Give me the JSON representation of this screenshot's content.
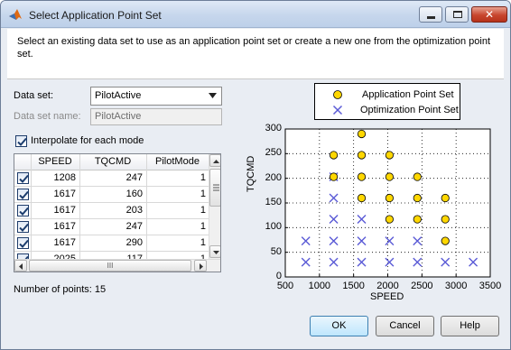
{
  "window": {
    "title": "Select Application Point Set",
    "close_glyph": "✕"
  },
  "description": "Select an existing data set to use as an application point set or create a new one from the optimization point set.",
  "form": {
    "data_set_label": "Data set:",
    "data_set_value": "PilotActive",
    "data_set_name_label": "Data set name:",
    "data_set_name_value": "PilotActive",
    "interpolate_label": "Interpolate for each mode",
    "interpolate_checked": true
  },
  "table": {
    "columns": [
      "SPEED",
      "TQCMD",
      "PilotMode"
    ],
    "rows": [
      {
        "checked": true,
        "speed": "1208",
        "tqcmd": "247",
        "mode": "1"
      },
      {
        "checked": true,
        "speed": "1617",
        "tqcmd": "160",
        "mode": "1"
      },
      {
        "checked": true,
        "speed": "1617",
        "tqcmd": "203",
        "mode": "1"
      },
      {
        "checked": true,
        "speed": "1617",
        "tqcmd": "247",
        "mode": "1"
      },
      {
        "checked": true,
        "speed": "1617",
        "tqcmd": "290",
        "mode": "1"
      },
      {
        "checked": true,
        "speed": "2025",
        "tqcmd": "117",
        "mode": "1"
      }
    ],
    "hscroll_grip": "III"
  },
  "point_count": "Number of points: 15",
  "buttons": {
    "ok": "OK",
    "cancel": "Cancel",
    "help": "Help"
  },
  "colors": {
    "application_marker": "#ffd700",
    "optimization_marker": "#5a5ad6"
  },
  "chart_data": {
    "type": "scatter",
    "title": "",
    "xlabel": "SPEED",
    "ylabel": "TQCMD",
    "xlim": [
      500,
      3500
    ],
    "ylim": [
      0,
      300
    ],
    "xticks": [
      "500",
      "1000",
      "1500",
      "2000",
      "2500",
      "3000",
      "3500"
    ],
    "yticks": [
      "0",
      "50",
      "100",
      "150",
      "200",
      "250",
      "300"
    ],
    "grid": true,
    "legend_position": "above-right",
    "series": [
      {
        "name": "Application Point Set",
        "marker": "circle",
        "points": [
          [
            1208,
            247
          ],
          [
            1617,
            290
          ],
          [
            1617,
            247
          ],
          [
            1617,
            203
          ],
          [
            1617,
            160
          ],
          [
            1208,
            203
          ],
          [
            2025,
            247
          ],
          [
            2025,
            203
          ],
          [
            2025,
            160
          ],
          [
            2025,
            117
          ],
          [
            2433,
            203
          ],
          [
            2433,
            160
          ],
          [
            2433,
            117
          ],
          [
            2842,
            160
          ],
          [
            2842,
            117
          ],
          [
            2842,
            73
          ]
        ]
      },
      {
        "name": "Optimization Point Set",
        "marker": "x",
        "points": [
          [
            800,
            30
          ],
          [
            800,
            73
          ],
          [
            1208,
            30
          ],
          [
            1208,
            73
          ],
          [
            1208,
            117
          ],
          [
            1208,
            160
          ],
          [
            1208,
            203
          ],
          [
            1617,
            30
          ],
          [
            1617,
            73
          ],
          [
            1617,
            117
          ],
          [
            2025,
            30
          ],
          [
            2025,
            73
          ],
          [
            2433,
            30
          ],
          [
            2433,
            73
          ],
          [
            2842,
            30
          ],
          [
            3250,
            30
          ]
        ]
      }
    ]
  }
}
